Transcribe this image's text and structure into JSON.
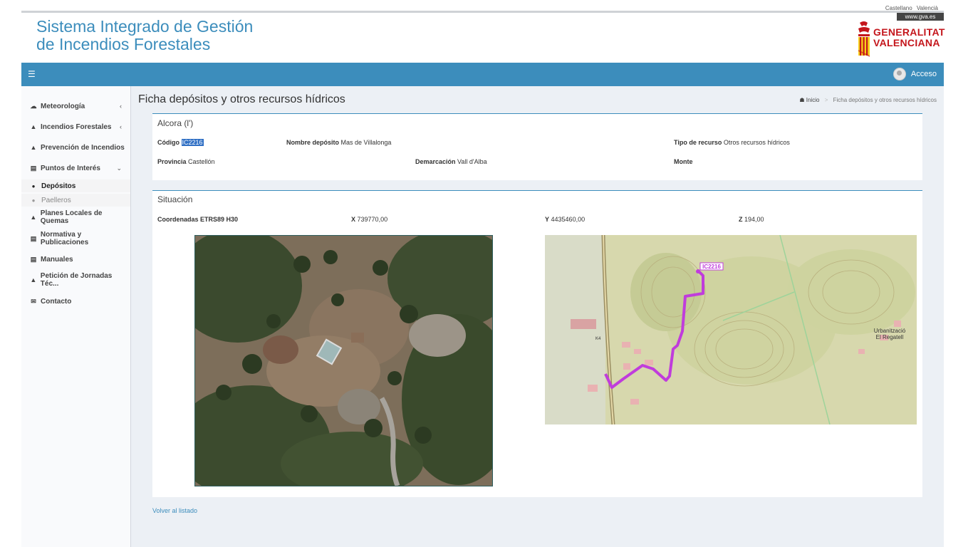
{
  "header": {
    "title_line1": "Sistema Integrado de Gestión",
    "title_line2": "de Incendios Forestales",
    "lang_castellano": "Castellano",
    "lang_valencia": "Valencià",
    "gva_link": "www.gva.es",
    "logo_line1": "GENERALITAT",
    "logo_line2": "VALENCIANA"
  },
  "navbar": {
    "menu_icon": "hamburger-icon",
    "login_label": "Acceso"
  },
  "sidebar": {
    "items": [
      {
        "label": "Meteorología",
        "icon": "cloud-sun-icon",
        "chevron": "‹"
      },
      {
        "label": "Incendios Forestales",
        "icon": "fire-icon",
        "chevron": "‹"
      },
      {
        "label": "Prevención de Incendios",
        "icon": "tree-icon"
      },
      {
        "label": "Puntos de Interés",
        "icon": "bank-icon",
        "chevron": "⌄"
      },
      {
        "label": "Planes Locales de Quemas",
        "icon": "fire-small-icon"
      },
      {
        "label": "Normativa y Publicaciones",
        "icon": "document-icon"
      },
      {
        "label": "Manuales",
        "icon": "document-icon"
      },
      {
        "label": "Petición de Jornadas Téc...",
        "icon": "graduation-cap-icon"
      },
      {
        "label": "Contacto",
        "icon": "envelope-icon"
      }
    ],
    "subitems": [
      {
        "label": "Depósitos",
        "icon": "drop-icon"
      },
      {
        "label": "Paelleros",
        "icon": "circle-icon"
      }
    ]
  },
  "main": {
    "page_title": "Ficha depósitos y otros recursos hídricos",
    "breadcrumb_home": "Inicio",
    "breadcrumb_current": "Ficha depósitos y otros recursos hídricos",
    "deposit_box": {
      "title": "Alcora (l')",
      "codigo_label": "Código",
      "codigo_value": "IC2216",
      "nombre_label": "Nombre depósito",
      "nombre_value": "Mas de Villalonga",
      "tipo_label": "Tipo de recurso",
      "tipo_value": "Otros recursos hídricos",
      "provincia_label": "Provincia",
      "provincia_value": "Castellón",
      "demarcacion_label": "Demarcación",
      "demarcacion_value": "Vall d'Alba",
      "monte_label": "Monte",
      "monte_value": ""
    },
    "situacion_box": {
      "title": "Situación",
      "coords_label": "Coordenadas ETRS89 H30",
      "x_label": "X",
      "x_value": "739770,00",
      "y_label": "Y",
      "y_value": "4435460,00",
      "z_label": "Z",
      "z_value": "194,00",
      "map_marker_label": "IC2216",
      "map_place_label_1": "Urbanització",
      "map_place_label_2": "El Regatell",
      "map_road_label": "K4"
    },
    "back_link": "Volver al listado"
  },
  "colors": {
    "brand_blue": "#3c8dbc",
    "gva_red": "#c4161c",
    "route_purple": "#c03cdc"
  }
}
